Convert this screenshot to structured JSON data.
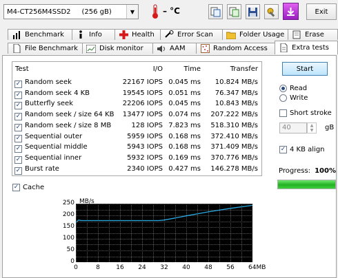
{
  "toolbar": {
    "drive_name": "M4-CT256M4SSD2",
    "drive_capacity": "(256 gB)",
    "temperature": "– °C",
    "exit_label": "Exit"
  },
  "tabs_row1": [
    {
      "label": "Benchmark",
      "icon": "benchmark-icon"
    },
    {
      "label": "Info",
      "icon": "info-icon"
    },
    {
      "label": "Health",
      "icon": "health-cross-icon"
    },
    {
      "label": "Error Scan",
      "icon": "error-scan-icon"
    },
    {
      "label": "Folder Usage",
      "icon": "folder-icon"
    },
    {
      "label": "Erase",
      "icon": "erase-icon"
    }
  ],
  "tabs_row2": [
    {
      "label": "File Benchmark",
      "icon": "file-icon"
    },
    {
      "label": "Disk monitor",
      "icon": "monitor-chart-icon"
    },
    {
      "label": "AAM",
      "icon": "speaker-icon"
    },
    {
      "label": "Random Access",
      "icon": "random-access-icon"
    },
    {
      "label": "Extra tests",
      "icon": "page-icon",
      "active": true
    }
  ],
  "table": {
    "headers": {
      "test": "Test",
      "io": "I/O",
      "time": "Time",
      "transfer": "Transfer"
    },
    "rows": [
      {
        "checked": true,
        "test": "Random seek",
        "io": "22167 IOPS",
        "time": "0.045 ms",
        "transfer": "10.824 MB/s"
      },
      {
        "checked": true,
        "test": "Random seek 4 KB",
        "io": "19545 IOPS",
        "time": "0.051 ms",
        "transfer": "76.347 MB/s"
      },
      {
        "checked": true,
        "test": "Butterfly seek",
        "io": "22206 IOPS",
        "time": "0.045 ms",
        "transfer": "10.843 MB/s"
      },
      {
        "checked": true,
        "test": "Random seek / size 64 KB",
        "io": "13477 IOPS",
        "time": "0.074 ms",
        "transfer": "207.222 MB/s"
      },
      {
        "checked": true,
        "test": "Random seek / size 8 MB",
        "io": "128 IOPS",
        "time": "7.823 ms",
        "transfer": "518.310 MB/s"
      },
      {
        "checked": true,
        "test": "Sequential outer",
        "io": "5959 IOPS",
        "time": "0.168 ms",
        "transfer": "372.410 MB/s"
      },
      {
        "checked": true,
        "test": "Sequential middle",
        "io": "5943 IOPS",
        "time": "0.168 ms",
        "transfer": "371.409 MB/s"
      },
      {
        "checked": true,
        "test": "Sequential inner",
        "io": "5932 IOPS",
        "time": "0.169 ms",
        "transfer": "370.776 MB/s"
      },
      {
        "checked": true,
        "test": "Burst rate",
        "io": "2340 IOPS",
        "time": "0.427 ms",
        "transfer": "146.278 MB/s"
      }
    ]
  },
  "cache_label": "Cache",
  "controls": {
    "start_label": "Start",
    "read_label": "Read",
    "write_label": "Write",
    "short_stroke_label": "Short stroke",
    "short_stroke_value": "40",
    "short_stroke_unit": "gB",
    "align_label": "4 KB align",
    "progress_label": "Progress:",
    "progress_value": "100%",
    "progress_fraction": 1.0
  },
  "chart_data": {
    "type": "line",
    "ylabel": "MB/s",
    "xlabel_unit": "MB",
    "ylim": [
      0,
      250
    ],
    "xlim": [
      0,
      64
    ],
    "yticks": [
      "250",
      "200",
      "150",
      "100",
      "50",
      "0"
    ],
    "xticks": [
      "0",
      "8",
      "16",
      "24",
      "32",
      "40",
      "48",
      "56",
      "64MB"
    ],
    "grid": true,
    "series": [
      {
        "color": "#29a9e1",
        "x": [
          0,
          1,
          2,
          4,
          8,
          16,
          24,
          30,
          32,
          40,
          48,
          56,
          64
        ],
        "y": [
          170,
          180,
          178,
          178,
          178,
          178,
          178,
          178,
          180,
          198,
          215,
          230,
          243
        ]
      }
    ]
  }
}
